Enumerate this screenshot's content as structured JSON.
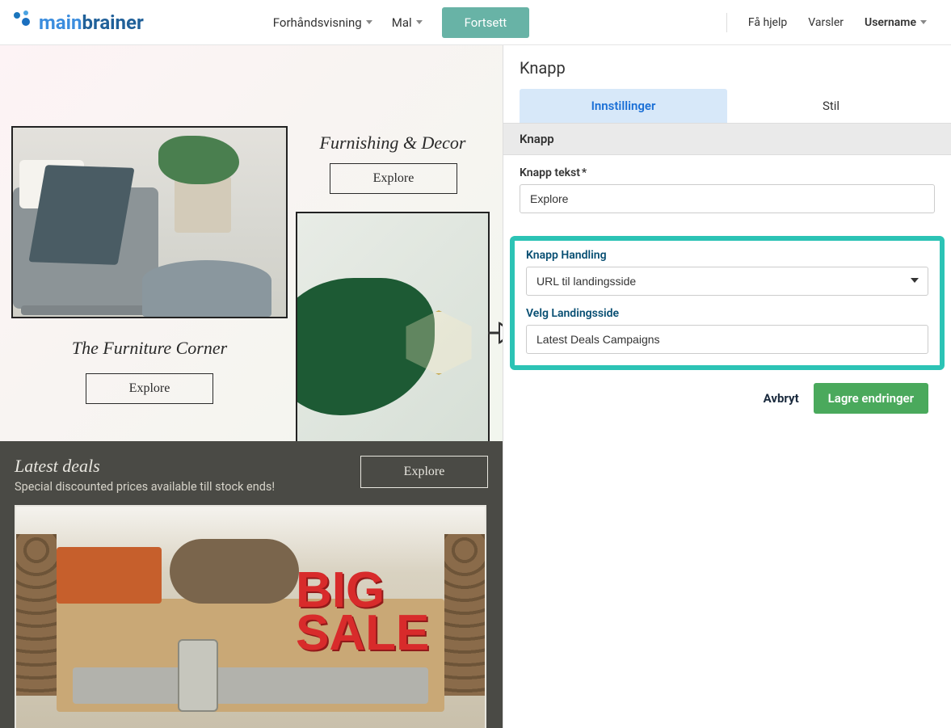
{
  "nav": {
    "logo_main": "main",
    "logo_brainer": "brainer",
    "preview": "Forhåndsvisning",
    "template": "Mal",
    "continue": "Fortsett",
    "help": "Få hjelp",
    "alerts": "Varsler",
    "username": "Username"
  },
  "canvas": {
    "furniture_title": "The Furniture Corner",
    "explore1": "Explore",
    "furnishing_title": "Furnishing & Decor",
    "explore2": "Explore",
    "deals_title": "Latest deals",
    "deals_sub": "Special discounted prices available till stock ends!",
    "explore3": "Explore",
    "bigsale_line1": "BIG",
    "bigsale_line2": "SALE"
  },
  "panel": {
    "title": "Knapp",
    "tab_settings": "Innstillinger",
    "tab_style": "Stil",
    "section_label": "Knapp",
    "button_text_label": "Knapp tekst",
    "button_text_value": "Explore",
    "action_label": "Knapp Handling",
    "action_value": "URL til landingsside",
    "landing_label": "Velg Landingsside",
    "landing_value": "Latest Deals Campaigns",
    "cancel": "Avbryt",
    "save": "Lagre endringer"
  }
}
